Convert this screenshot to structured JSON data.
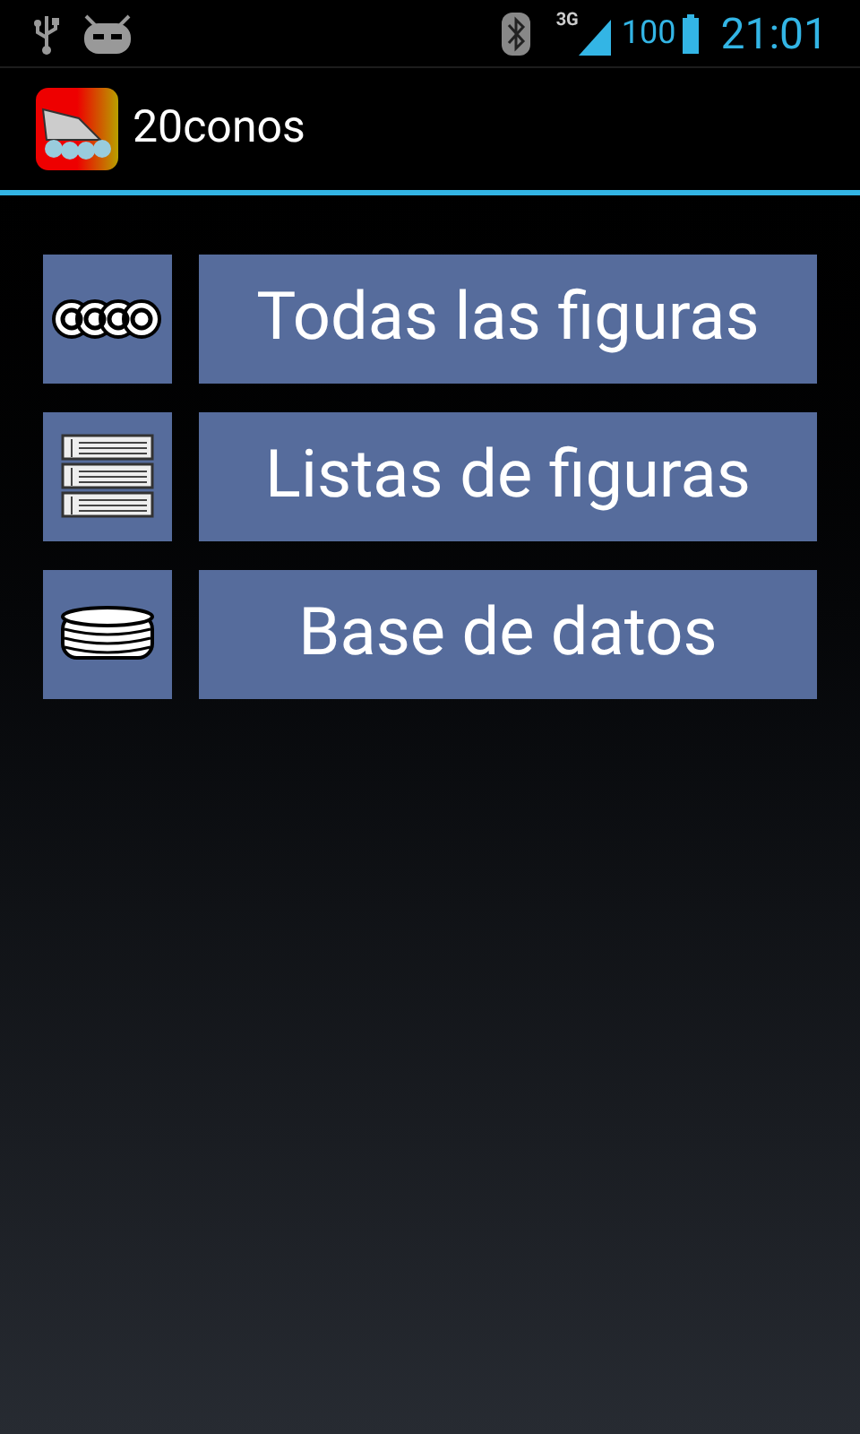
{
  "status_bar": {
    "network": "3G",
    "battery": "100",
    "time": "21:01"
  },
  "action_bar": {
    "title": "20conos"
  },
  "menu": [
    {
      "kind": "cones",
      "label": "Todas las figuras"
    },
    {
      "kind": "lists",
      "label": "Listas de figuras"
    },
    {
      "kind": "database",
      "label": "Base de datos"
    }
  ]
}
